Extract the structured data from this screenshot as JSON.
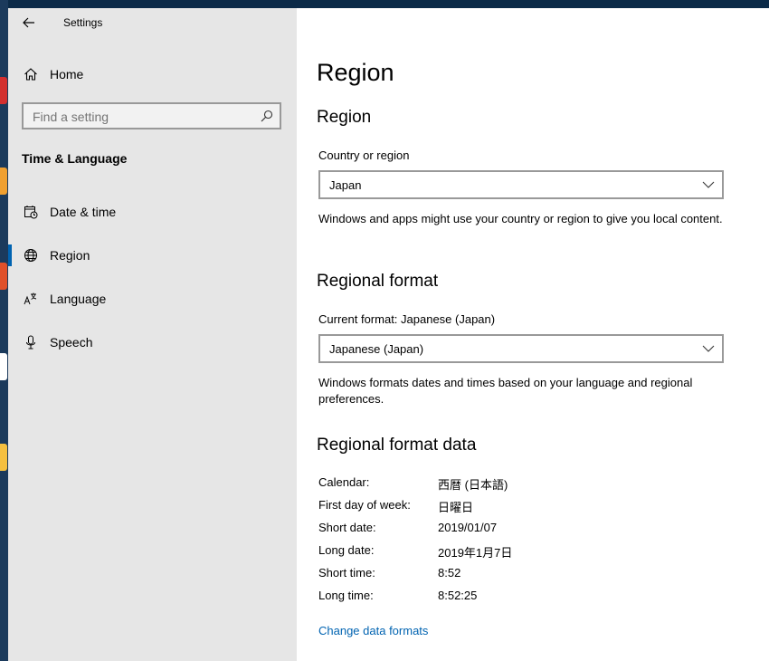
{
  "window": {
    "title": "Settings"
  },
  "sidebar": {
    "home_label": "Home",
    "search_placeholder": "Find a setting",
    "section_title": "Time & Language",
    "items": [
      {
        "label": "Date & time",
        "icon": "calendar-clock-icon",
        "active": false
      },
      {
        "label": "Region",
        "icon": "globe-icon",
        "active": true
      },
      {
        "label": "Language",
        "icon": "language-icon",
        "active": false
      },
      {
        "label": "Speech",
        "icon": "microphone-icon",
        "active": false
      }
    ]
  },
  "main": {
    "page_title": "Region",
    "region": {
      "heading": "Region",
      "country_label": "Country or region",
      "country_value": "Japan",
      "description": "Windows and apps might use your country or region to give you local content."
    },
    "format": {
      "heading": "Regional format",
      "current_label": "Current format: Japanese (Japan)",
      "value": "Japanese (Japan)",
      "description": "Windows formats dates and times based on your language and regional preferences."
    },
    "format_data": {
      "heading": "Regional format data",
      "rows": [
        {
          "key": "Calendar:",
          "value": "西暦 (日本語)"
        },
        {
          "key": "First day of week:",
          "value": "日曜日"
        },
        {
          "key": "Short date:",
          "value": "2019/01/07"
        },
        {
          "key": "Long date:",
          "value": "2019年1月7日"
        },
        {
          "key": "Short time:",
          "value": "8:52"
        },
        {
          "key": "Long time:",
          "value": "8:52:25"
        }
      ],
      "change_link": "Change data formats"
    }
  },
  "colors": {
    "accent": "#0063b1",
    "sidebar_bg": "#e6e6e6"
  }
}
